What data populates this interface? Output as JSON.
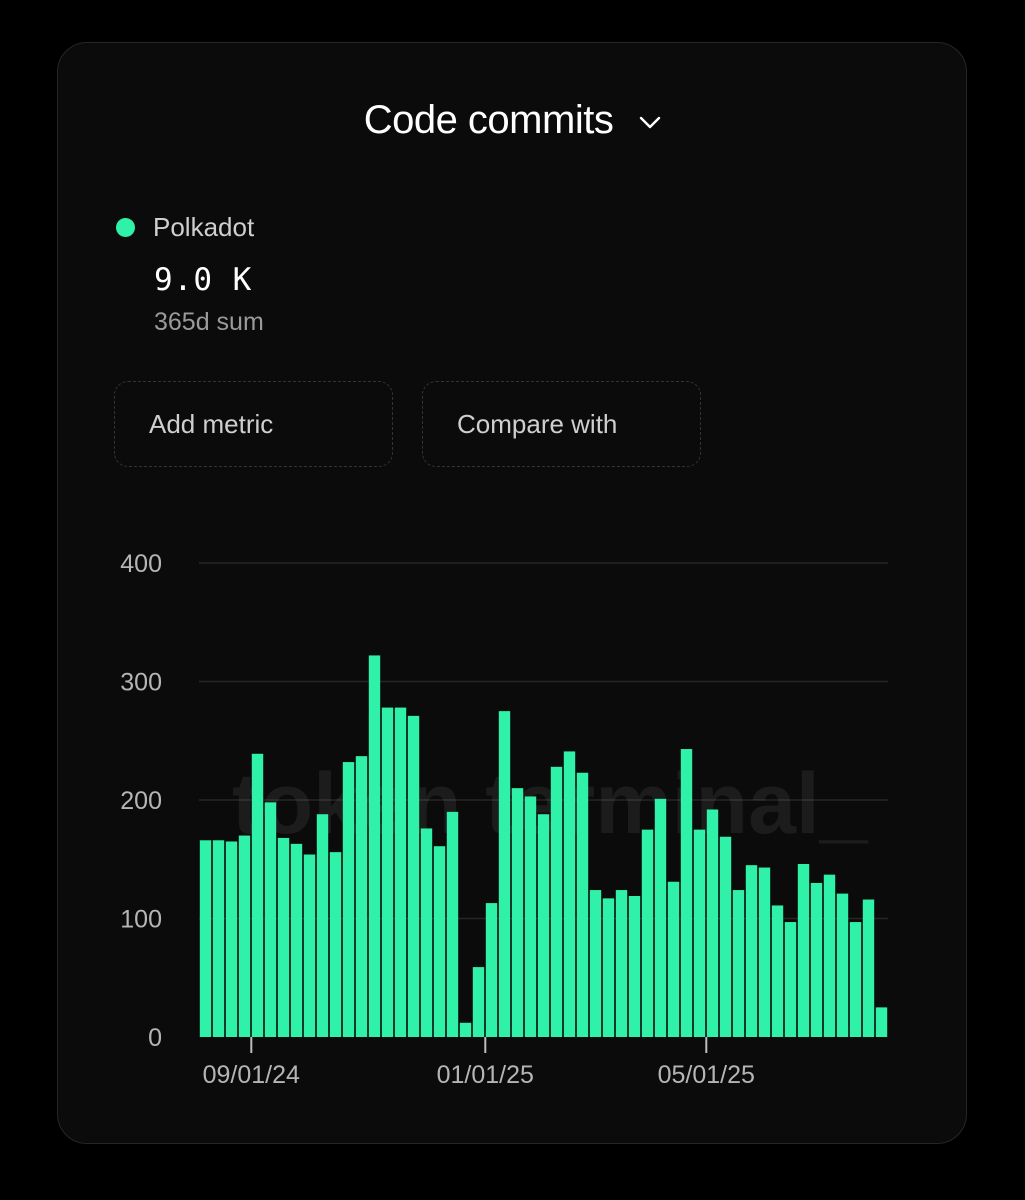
{
  "header": {
    "title": "Code commits",
    "dropdown_icon": "chevron-down-icon"
  },
  "legend": {
    "series_name": "Polkadot",
    "color": "#2ff2a8",
    "value": "9.0 K",
    "value_caption": "365d sum"
  },
  "actions": {
    "add_metric_label": "Add metric",
    "compare_label": "Compare with"
  },
  "watermark": "token terminal_",
  "colors": {
    "background": "#000000",
    "card": "#0b0b0b",
    "bar": "#2ff2a8",
    "gridline": "#262626"
  },
  "chart_data": {
    "type": "bar",
    "series": [
      {
        "name": "Polkadot",
        "values": [
          166,
          166,
          165,
          170,
          239,
          198,
          168,
          163,
          154,
          188,
          156,
          232,
          237,
          322,
          278,
          278,
          271,
          176,
          161,
          190,
          12,
          59,
          113,
          275,
          210,
          203,
          188,
          228,
          241,
          223,
          124,
          117,
          124,
          119,
          175,
          201,
          131,
          243,
          175,
          192,
          169,
          124,
          145,
          143,
          111,
          97,
          146,
          130,
          137,
          121,
          97,
          116,
          25
        ]
      }
    ],
    "x_tick_labels": [
      "09/01/24",
      "01/01/25",
      "05/01/25"
    ],
    "y_ticks": [
      0,
      100,
      200,
      300,
      400
    ],
    "ylim": [
      0,
      400
    ],
    "grid": true,
    "legend_position": "top-left"
  }
}
